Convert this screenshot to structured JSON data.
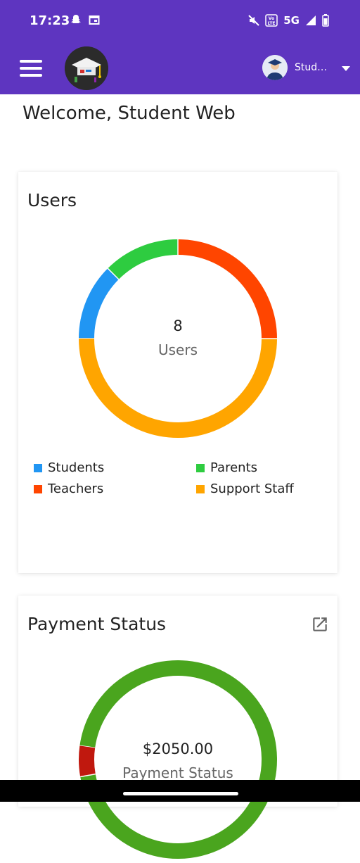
{
  "status_bar": {
    "time": "17:23",
    "network": "5G",
    "icons": [
      "snapchat-icon",
      "calendar-icon",
      "mute-icon",
      "volte-icon",
      "signal-icon",
      "battery-icon"
    ]
  },
  "app_bar": {
    "menu_icon": "hamburger-icon",
    "logo_icon": "school-logo",
    "user_label": "Stude...",
    "user_full_name": "Student",
    "dropdown_icon": "caret-down-icon",
    "background": "#5e35c0"
  },
  "welcome_text": "Welcome, Student Web",
  "users_card": {
    "title": "Users",
    "center_value": "8",
    "center_label": "Users",
    "chart_data": {
      "type": "pie",
      "title": "Users",
      "center_value": 8,
      "categories": [
        "Students",
        "Parents",
        "Teachers",
        "Support Staff"
      ],
      "values": [
        1,
        1,
        2,
        4
      ],
      "colors": [
        "#2196f3",
        "#2ecc40",
        "#ff4500",
        "#ffa500"
      ],
      "legend": "bottom"
    },
    "legend": [
      {
        "label": "Students",
        "color": "#2196f3"
      },
      {
        "label": "Parents",
        "color": "#2ecc40"
      },
      {
        "label": "Teachers",
        "color": "#ff4500"
      },
      {
        "label": "Support Staff",
        "color": "#ffa500"
      }
    ]
  },
  "payment_card": {
    "title": "Payment Status",
    "center_value": "$2050.00",
    "center_label": "Payment Status",
    "open_icon": "open-external-icon",
    "chart_data": {
      "type": "pie",
      "title": "Payment Status",
      "center_value": "$2050.00",
      "values": [
        0.95,
        0.05
      ],
      "colors": [
        "#4aa51e",
        "#c0180e"
      ]
    }
  }
}
